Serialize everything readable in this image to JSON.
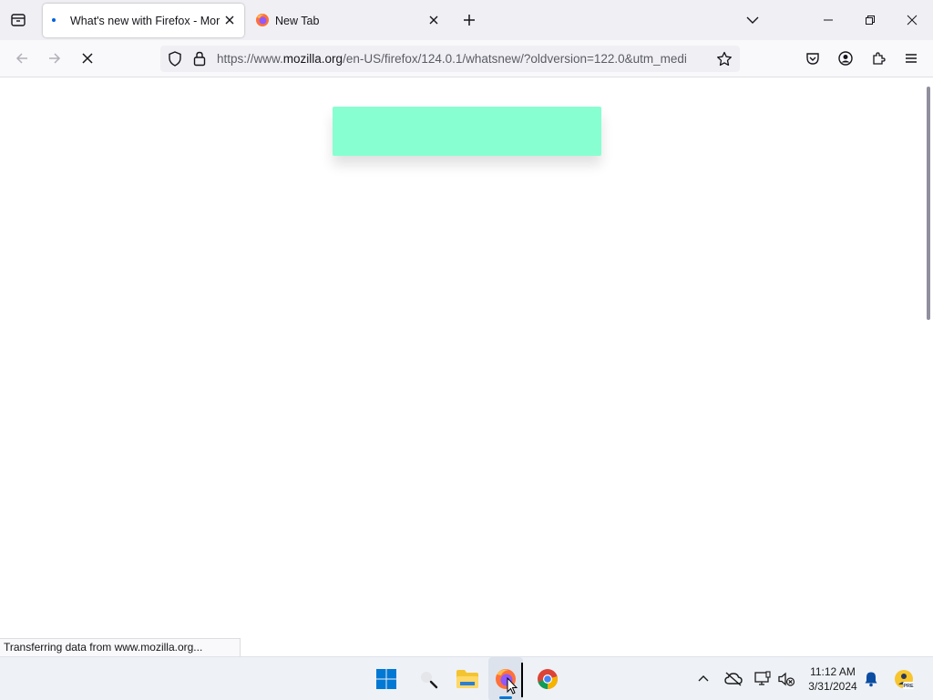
{
  "browser": {
    "tabs": [
      {
        "title": "What's new with Firefox - More",
        "state": "loading"
      },
      {
        "title": "New Tab",
        "state": "idle"
      }
    ],
    "url": {
      "prefix": "https://www.",
      "host": "mozilla.org",
      "path": "/en-US/firefox/124.0.1/whatsnew/?oldversion=122.0&utm_medi"
    },
    "status_text": "Transferring data from www.mozilla.org..."
  },
  "page": {
    "banner_color": "#88ffd1"
  },
  "taskbar": {
    "time": "11:12 AM",
    "date": "3/31/2024",
    "pinned_apps": [
      "start",
      "search",
      "file-explorer",
      "firefox",
      "chrome"
    ]
  },
  "colors": {
    "accent": "#0060df",
    "firefox_orange": "#ff7139",
    "windows_blue": "#0078d4"
  }
}
